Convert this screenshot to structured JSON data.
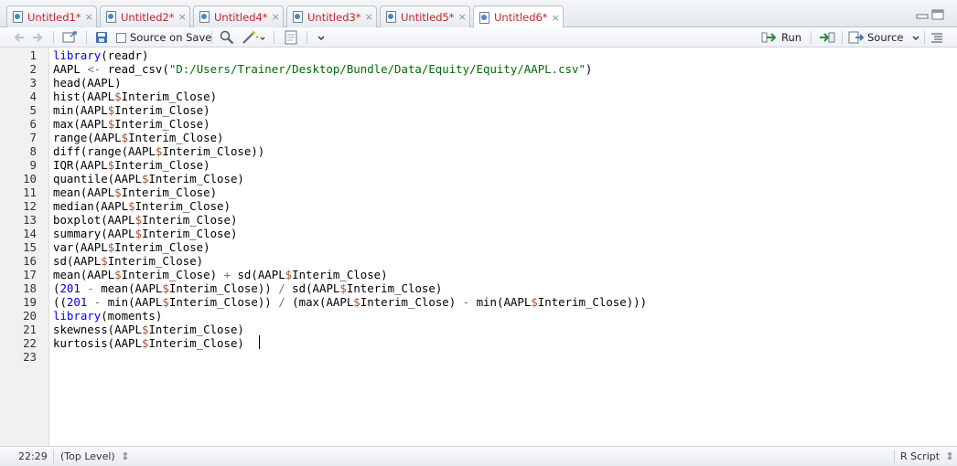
{
  "tabs": [
    {
      "label": "Untitled1*",
      "active": false
    },
    {
      "label": "Untitled2*",
      "active": false
    },
    {
      "label": "Untitled4*",
      "active": false
    },
    {
      "label": "Untitled3*",
      "active": false
    },
    {
      "label": "Untitled5*",
      "active": false
    },
    {
      "label": "Untitled6*",
      "active": true
    }
  ],
  "tab_close_glyph": "×",
  "toolbar": {
    "source_on_save_label": "Source on Save",
    "source_on_save_checked": false,
    "run_label": "Run",
    "source_label": "Source",
    "icons": [
      "back-arrow-icon",
      "forward-arrow-icon",
      "show-in-window-icon",
      "save-icon",
      "search-icon",
      "magic-wand-icon",
      "compile-report-icon",
      "re-run-icon",
      "outline-icon"
    ]
  },
  "editor": {
    "line_numbers": [
      "1",
      "2",
      "3",
      "4",
      "5",
      "6",
      "7",
      "8",
      "9",
      "10",
      "11",
      "12",
      "13",
      "14",
      "15",
      "16",
      "17",
      "18",
      "19",
      "20",
      "21",
      "22",
      "23"
    ],
    "lines": [
      "library(readr)",
      "AAPL <- read_csv(\"D:/Users/Trainer/Desktop/Bundle/Data/Equity/Equity/AAPL.csv\")",
      "head(AAPL)",
      "hist(AAPL$Interim_Close)",
      "min(AAPL$Interim_Close)",
      "max(AAPL$Interim_Close)",
      "range(AAPL$Interim_Close)",
      "diff(range(AAPL$Interim_Close))",
      "IQR(AAPL$Interim_Close)",
      "quantile(AAPL$Interim_Close)",
      "mean(AAPL$Interim_Close)",
      "median(AAPL$Interim_Close)",
      "boxplot(AAPL$Interim_Close)",
      "summary(AAPL$Interim_Close)",
      "var(AAPL$Interim_Close)",
      "sd(AAPL$Interim_Close)",
      "mean(AAPL$Interim_Close) + sd(AAPL$Interim_Close)",
      "(201 - mean(AAPL$Interim_Close)) / sd(AAPL$Interim_Close)",
      "((201 - min(AAPL$Interim_Close)) / (max(AAPL$Interim_Close) - min(AAPL$Interim_Close)))",
      "library(moments)",
      "skewness(AAPL$Interim_Close)",
      "kurtosis(AAPL$Interim_Close)",
      ""
    ]
  },
  "status": {
    "cursor_position": "22:29",
    "scope": "(Top Level)",
    "file_type": "R Script"
  },
  "colors": {
    "keyword": "#0000ff",
    "string": "#036a07",
    "number": "#0000cd",
    "tab_label": "#c0282b"
  }
}
